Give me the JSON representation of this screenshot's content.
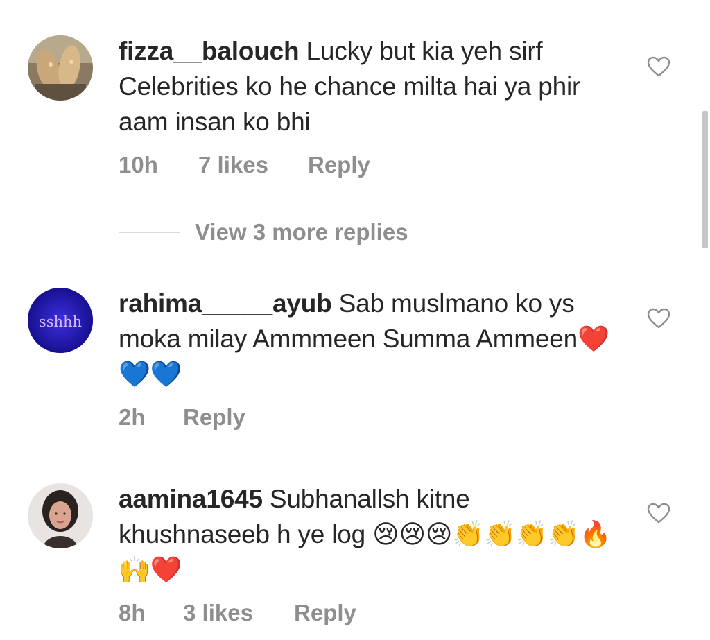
{
  "comments": [
    {
      "username": "fizza__balouch",
      "text": " Lucky but kia yeh sirf Celebrities ko he chance milta hai ya phir aam insan ko bhi",
      "time": "10h",
      "likes": "7 likes",
      "reply_label": "Reply",
      "avatar_icon": "avatar-photo-hands"
    },
    {
      "username": "rahima_____ayub",
      "text": " Sab muslmano ko ys moka milay Ammmeen Summa Ammeen❤️💙💙",
      "time": "2h",
      "reply_label": "Reply",
      "avatar_text": "sshhh",
      "avatar_icon": "avatar-neon-text"
    },
    {
      "username": "aamina1645",
      "text": " Subhanallsh kitne khushnaseeb h ye log 😢😢😢👏👏👏👏🔥🙌❤️",
      "time": "8h",
      "likes": "3 likes",
      "reply_label": "Reply",
      "avatar_icon": "avatar-photo-woman"
    }
  ],
  "view_replies_label": "View 3 more replies",
  "colors": {
    "text": "#262626",
    "meta": "#8e8e8e",
    "divider": "#dbdbdb",
    "neon": "#b07cff"
  }
}
